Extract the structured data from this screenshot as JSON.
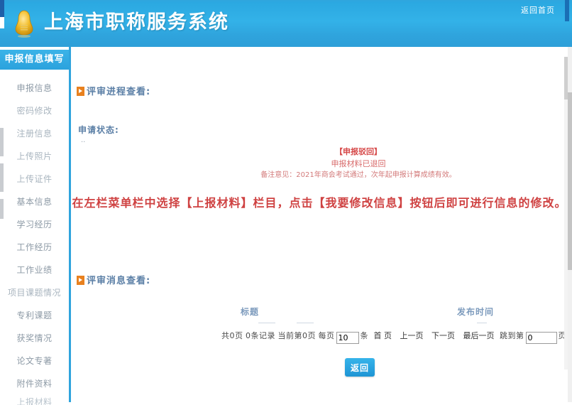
{
  "header": {
    "site_title": "上海市职称服务系统",
    "home_link": "返回首页",
    "logo_icon": "shield-emblem-icon"
  },
  "sidebar": {
    "heading": "申报信息填写",
    "items": [
      {
        "label": "申报信息"
      },
      {
        "label": "密码修改"
      },
      {
        "label": "注册信息"
      },
      {
        "label": "上传照片"
      },
      {
        "label": "上传证件"
      },
      {
        "label": "基本信息"
      },
      {
        "label": "学习经历"
      },
      {
        "label": "工作经历"
      },
      {
        "label": "工作业绩"
      },
      {
        "label": "项目课题情况"
      },
      {
        "label": "专利课题"
      },
      {
        "label": "获奖情况"
      },
      {
        "label": "论文专著"
      },
      {
        "label": "附件资料"
      },
      {
        "label": "上报材料"
      }
    ]
  },
  "main": {
    "progress_section": {
      "title": "评审进程查看:",
      "status_label": "申请状态:",
      "status_dots": "..",
      "status_tag": "【申报驳回】",
      "status_line": "申报材料已退回",
      "status_note": "备注意见：2021年商会考试通过，次年起申报计算成绩有效。",
      "instruction": "在左栏菜单栏中选择【上报材料】栏目，点击【我要修改信息】按钮后即可进行信息的修改。"
    },
    "message_section": {
      "title": "评审消息查看:",
      "columns": {
        "title": "标题",
        "publish_time": "发布时间"
      },
      "rows": [],
      "pager": {
        "total_pages_prefix": "共",
        "total_pages": "0",
        "pages_unit": "页",
        "total_records": "0",
        "records_unit": "条记录",
        "current_prefix": "当前第",
        "current_page": "0",
        "current_unit": "页",
        "per_page_prefix": "每页",
        "per_page_value": "10",
        "per_page_unit": "条",
        "first": "首  页",
        "prev": "上一页",
        "next": "下一页",
        "last": "最后一页",
        "jump_prefix": "跳到第",
        "jump_value": "0",
        "jump_unit": "页"
      }
    },
    "back_button": "返回"
  }
}
